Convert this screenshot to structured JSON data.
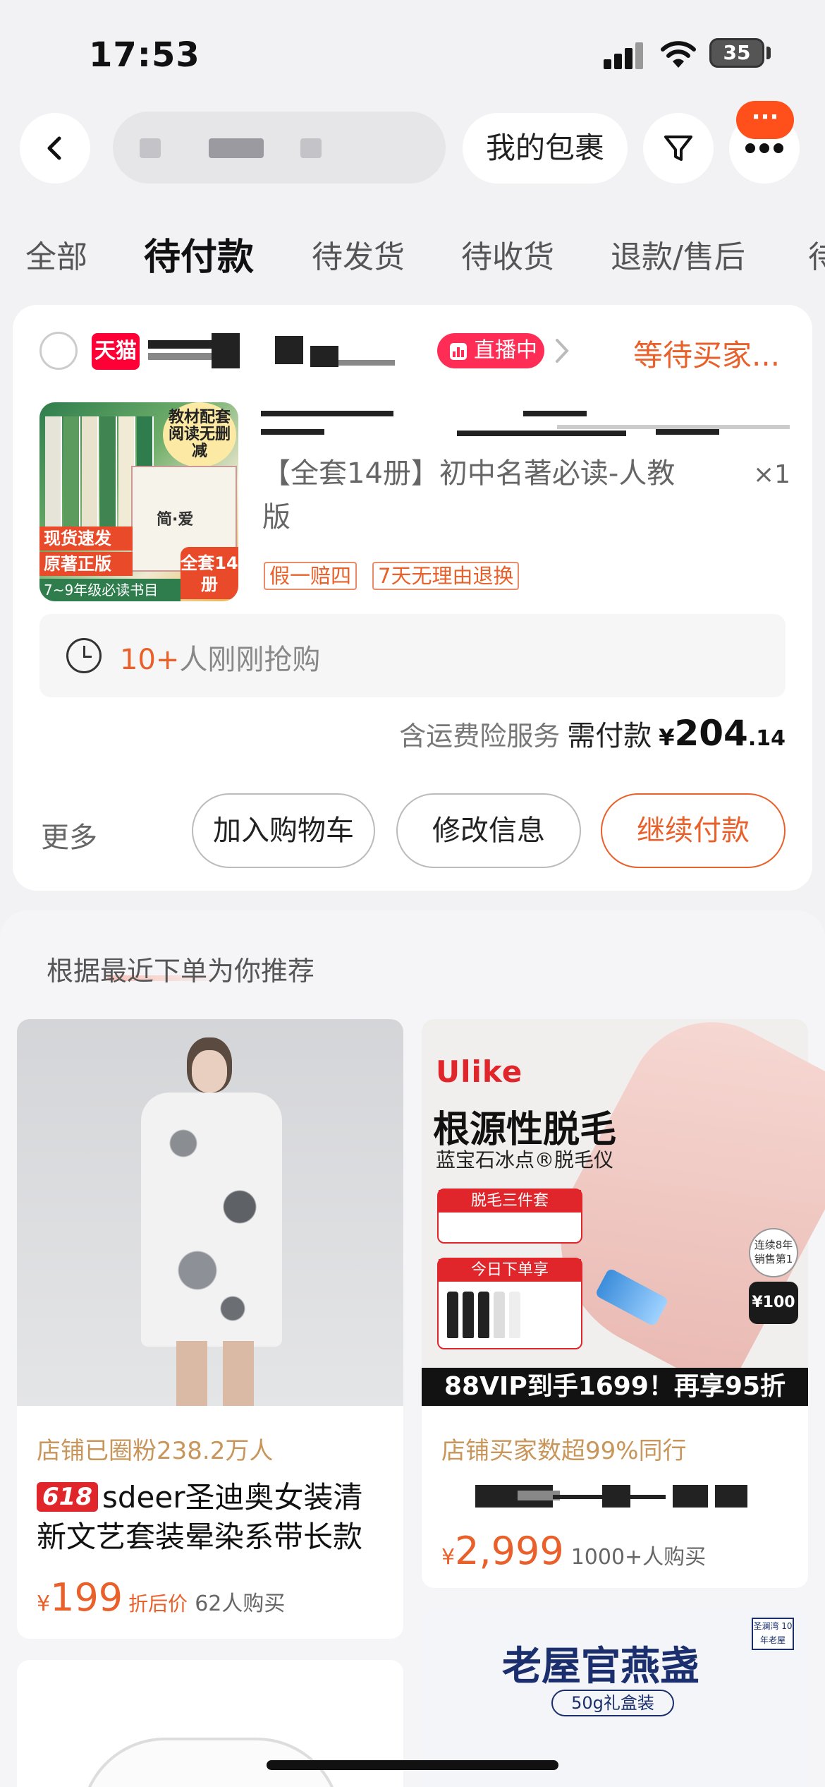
{
  "status_bar": {
    "time": "17:53",
    "battery": "35"
  },
  "top_bar": {
    "my_package_label": "我的包裹",
    "message_badge": "···"
  },
  "tabs": [
    {
      "label": "全部"
    },
    {
      "label": "待付款"
    },
    {
      "label": "待发货"
    },
    {
      "label": "待收货"
    },
    {
      "label": "退款/售后"
    },
    {
      "label": "待"
    }
  ],
  "active_tab_index": 1,
  "order": {
    "shop_badge": "天猫",
    "live_label": "直播中",
    "status": "等待买家...",
    "product": {
      "title": "【全套14册】初中名著必读-人教版",
      "quantity": "×1",
      "thumb_tag_top": "教材配套阅读无删减",
      "thumb_strip_1": "现货速发",
      "thumb_strip_2": "原著正版",
      "thumb_strip_3": "7~9年级必读书目",
      "thumb_tag_bottom": "全套14册",
      "thumb_book_title": "简·爱",
      "service_tags": [
        "假一赔四",
        "7天无理由退换"
      ]
    },
    "grab_count": "10+",
    "grab_text": "人刚刚抢购",
    "shipping_insurance": "含运费险服务",
    "need_pay_label": "需付款",
    "currency": "¥",
    "price_int": "204",
    "price_dec": ".14",
    "more_label": "更多",
    "buttons": {
      "add_cart": "加入购物车",
      "modify": "修改信息",
      "continue_pay": "继续付款"
    }
  },
  "recommend": {
    "title": "根据最近下单为你推荐",
    "items": [
      {
        "meta": "店铺已圈粉238.2万人",
        "badge": "618",
        "title": "sdeer圣迪奥女装清新文艺套装晕染系带长款",
        "currency": "¥",
        "price": "199",
        "price_note": "折后价",
        "sold": "62人购买"
      },
      {
        "brand": "Ulike",
        "headline": "根源性脱毛",
        "subline": "蓝宝石冰点®脱毛仪",
        "promo_1": "脱毛三件套",
        "promo_2": "今日下单享",
        "seal_1": "连续8年销售第1",
        "seal_2": "¥100",
        "banner": "88VIP到手1699！再享95折",
        "meta": "店铺买家数超99%同行",
        "currency": "¥",
        "price": "2,999",
        "sold": "1000+人购买"
      },
      {},
      {
        "headline": "老屋官燕盏",
        "subline": "50g礼盒装",
        "badge": "圣澜湾 10年老屋"
      }
    ]
  },
  "colors": {
    "accent_orange": "#e9602a",
    "tmall_red": "#ff0036",
    "live_pink": "#ff2d55",
    "background": "#f2f2f4"
  }
}
